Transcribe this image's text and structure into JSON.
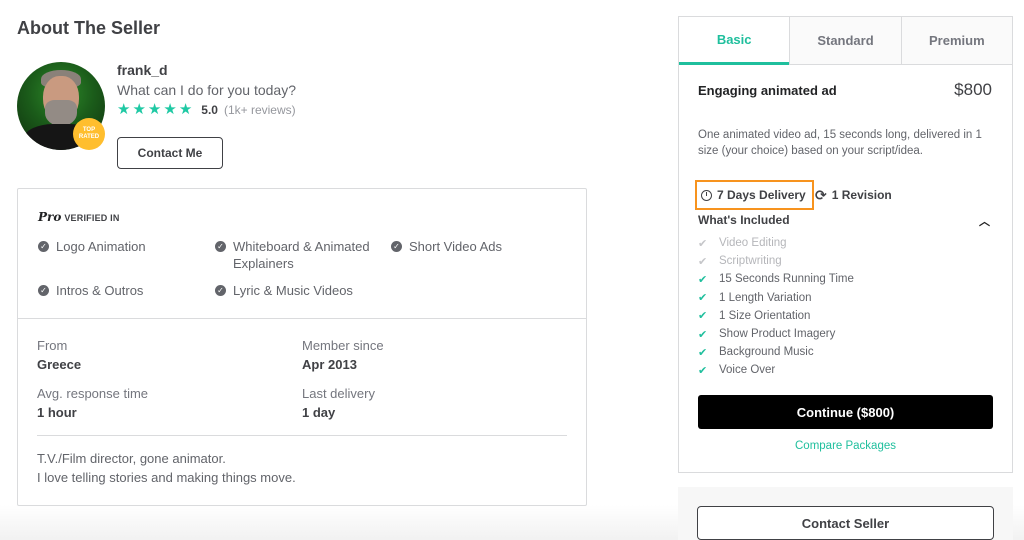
{
  "about": {
    "title": "About The Seller",
    "badge": [
      "TOP",
      "RATED"
    ],
    "seller_name": "frank_d",
    "tagline": "What can I do for you today?",
    "rating": {
      "stars": 5,
      "max_stars": 5,
      "score": "5.0",
      "count": "(1k+ reviews)",
      "star_color": "#1fc9a4"
    },
    "contact_button": "Contact Me"
  },
  "verified": {
    "pro_mark": "Pro",
    "label": "VERIFIED IN",
    "skills": [
      "Logo Animation",
      "Whiteboard & Animated Explainers",
      "Short Video Ads",
      "Intros & Outros",
      "Lyric & Music Videos"
    ]
  },
  "stats": [
    {
      "label": "From",
      "value": "Greece"
    },
    {
      "label": "Member since",
      "value": "Apr 2013"
    },
    {
      "label": "Avg. response time",
      "value": "1 hour"
    },
    {
      "label": "Last delivery",
      "value": "1 day"
    }
  ],
  "bio": [
    "T.V./Film director, gone animator.",
    "I love telling stories and making things move."
  ],
  "package": {
    "tabs": [
      {
        "label": "Basic",
        "active": true
      },
      {
        "label": "Standard",
        "active": false
      },
      {
        "label": "Premium",
        "active": false
      }
    ],
    "title": "Engaging animated ad",
    "price": "$800",
    "description": "One animated video ad, 15 seconds long, delivered in 1 size (your choice) based on your script/idea.",
    "delivery": "7 Days Delivery",
    "revisions": "1 Revision",
    "included_heading": "What's Included",
    "features": [
      {
        "label": "Video Editing",
        "included": false
      },
      {
        "label": "Scriptwriting",
        "included": false
      },
      {
        "label": "15 Seconds Running Time",
        "included": true
      },
      {
        "label": "1 Length Variation",
        "included": true
      },
      {
        "label": "1 Size Orientation",
        "included": true
      },
      {
        "label": "Show Product Imagery",
        "included": true
      },
      {
        "label": "Background Music",
        "included": true
      },
      {
        "label": "Voice Over",
        "included": true
      }
    ],
    "continue_button": "Continue ($800)",
    "compare_link": "Compare Packages",
    "accent_color": "#1fbf9d",
    "highlight_color": "#f7931e"
  },
  "contact_seller_button": "Contact Seller"
}
